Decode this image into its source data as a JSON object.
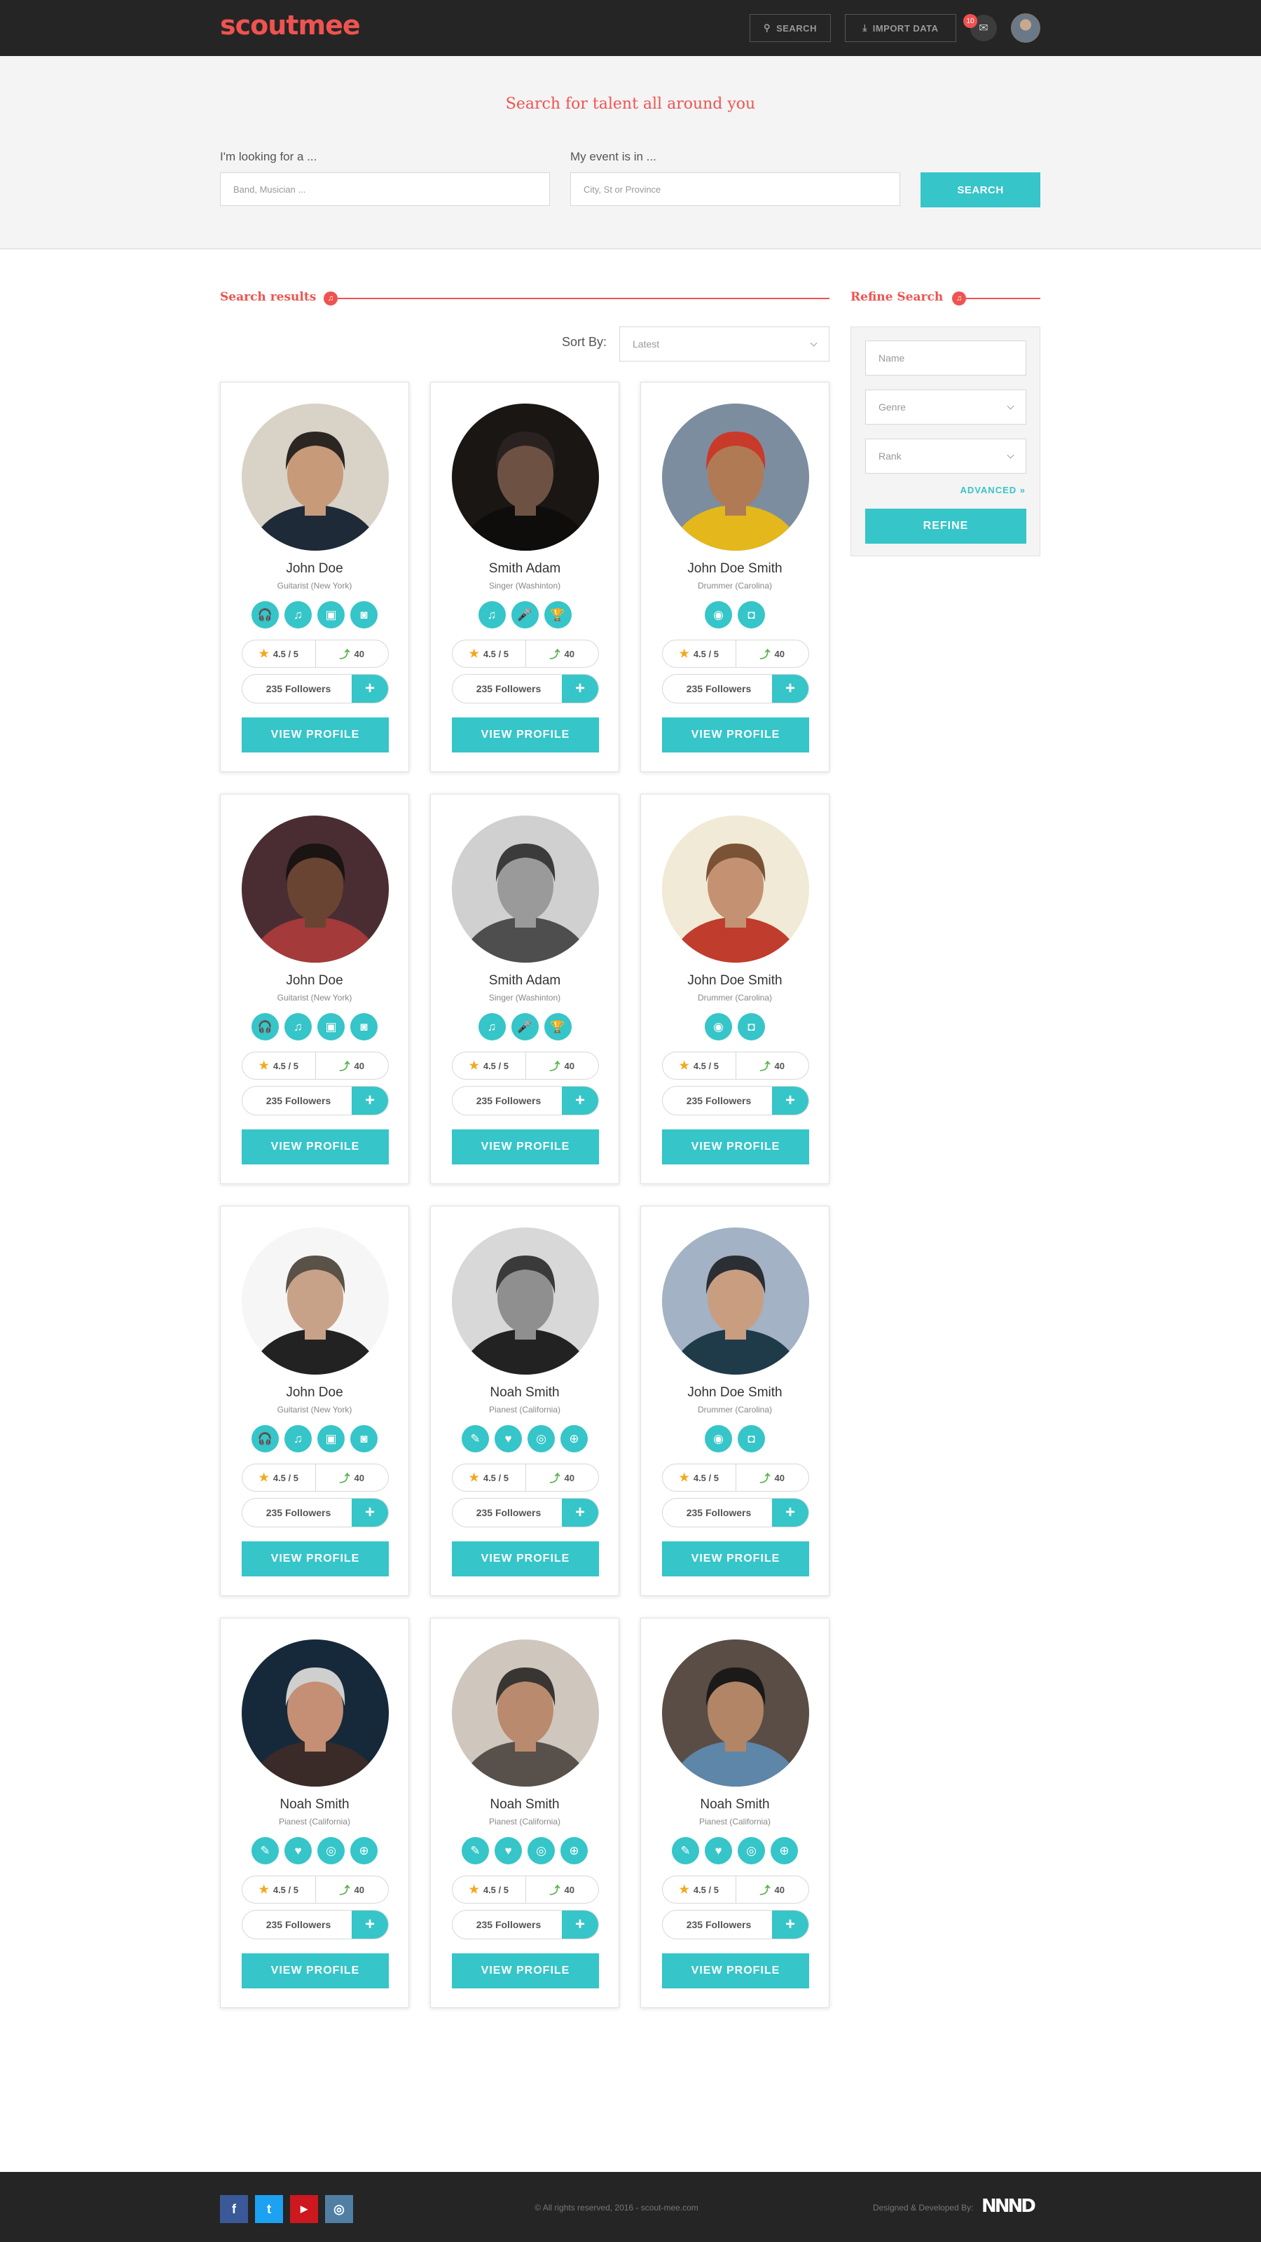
{
  "header": {
    "logo": "scoutmee",
    "search_label": "SEARCH",
    "import_label": "IMPORT DATA",
    "mail_badge": "10"
  },
  "hero": {
    "title": "Search for talent all around you",
    "looking_label": "I'm looking for a ...",
    "looking_placeholder": "Band, Musician ...",
    "event_label": "My event is in ...",
    "event_placeholder": "City, St or Province",
    "search_button": "SEARCH"
  },
  "results": {
    "title": "Search results",
    "sort_label": "Sort By:",
    "sort_value": "Latest"
  },
  "refine": {
    "title": "Refine Search",
    "name_placeholder": "Name",
    "genre_value": "Genre",
    "rank_value": "Rank",
    "advanced": "ADVANCED »",
    "button": "REFINE"
  },
  "cards": [
    {
      "name": "John Doe",
      "role": "Guitarist (New York)",
      "icons": [
        "headphones-icon",
        "music-note-icon",
        "amp-icon",
        "cassette-icon"
      ],
      "rating": "4.5 / 5",
      "rank": "40",
      "followers": "235 Followers",
      "view": "VIEW PROFILE"
    },
    {
      "name": "Smith Adam",
      "role": "Singer (Washinton)",
      "icons": [
        "music-note-icon",
        "microphone-icon",
        "trophy-icon"
      ],
      "rating": "4.5 / 5",
      "rank": "40",
      "followers": "235 Followers",
      "view": "VIEW PROFILE"
    },
    {
      "name": "John Doe Smith",
      "role": "Drummer (Carolina)",
      "icons": [
        "camera-icon",
        "drum-icon"
      ],
      "rating": "4.5 / 5",
      "rank": "40",
      "followers": "235 Followers",
      "view": "VIEW PROFILE"
    },
    {
      "name": "John Doe",
      "role": "Guitarist (New York)",
      "icons": [
        "headphones-icon",
        "music-note-icon",
        "amp-icon",
        "cassette-icon"
      ],
      "rating": "4.5 / 5",
      "rank": "40",
      "followers": "235 Followers",
      "view": "VIEW PROFILE"
    },
    {
      "name": "Smith Adam",
      "role": "Singer (Washinton)",
      "icons": [
        "music-note-icon",
        "microphone-icon",
        "trophy-icon"
      ],
      "rating": "4.5 / 5",
      "rank": "40",
      "followers": "235 Followers",
      "view": "VIEW PROFILE"
    },
    {
      "name": "John Doe Smith",
      "role": "Drummer (Carolina)",
      "icons": [
        "camera-icon",
        "drum-icon"
      ],
      "rating": "4.5 / 5",
      "rank": "40",
      "followers": "235 Followers",
      "view": "VIEW PROFILE"
    },
    {
      "name": "John Doe",
      "role": "Guitarist (New York)",
      "icons": [
        "headphones-icon",
        "music-note-icon",
        "amp-icon",
        "cassette-icon"
      ],
      "rating": "4.5 / 5",
      "rank": "40",
      "followers": "235 Followers",
      "view": "VIEW PROFILE"
    },
    {
      "name": "Noah Smith",
      "role": "Pianest (California)",
      "icons": [
        "pen-icon",
        "heart-icon",
        "disc-icon",
        "globe-icon"
      ],
      "rating": "4.5 / 5",
      "rank": "40",
      "followers": "235 Followers",
      "view": "VIEW PROFILE"
    },
    {
      "name": "John Doe Smith",
      "role": "Drummer (Carolina)",
      "icons": [
        "camera-icon",
        "drum-icon"
      ],
      "rating": "4.5 / 5",
      "rank": "40",
      "followers": "235 Followers",
      "view": "VIEW PROFILE"
    },
    {
      "name": "Noah Smith",
      "role": "Pianest (California)",
      "icons": [
        "pen-icon",
        "heart-icon",
        "disc-icon",
        "globe-icon"
      ],
      "rating": "4.5 / 5",
      "rank": "40",
      "followers": "235 Followers",
      "view": "VIEW PROFILE"
    },
    {
      "name": "Noah Smith",
      "role": "Pianest (California)",
      "icons": [
        "pen-icon",
        "heart-icon",
        "disc-icon",
        "globe-icon"
      ],
      "rating": "4.5 / 5",
      "rank": "40",
      "followers": "235 Followers",
      "view": "VIEW PROFILE"
    },
    {
      "name": "Noah Smith",
      "role": "Pianest (California)",
      "icons": [
        "pen-icon",
        "heart-icon",
        "disc-icon",
        "globe-icon"
      ],
      "rating": "4.5 / 5",
      "rank": "40",
      "followers": "235 Followers",
      "view": "VIEW PROFILE"
    }
  ],
  "footer": {
    "social": [
      "f",
      "t",
      "▶",
      "◎"
    ],
    "copyright": "© All rights reserved, 2016 - scout-mee.com",
    "designed_by": "Designed & Developed By:",
    "dev_logo": "NNND"
  },
  "colors": {
    "accent": "#36c5c8",
    "brand": "#ef5350",
    "dark": "#252525"
  }
}
